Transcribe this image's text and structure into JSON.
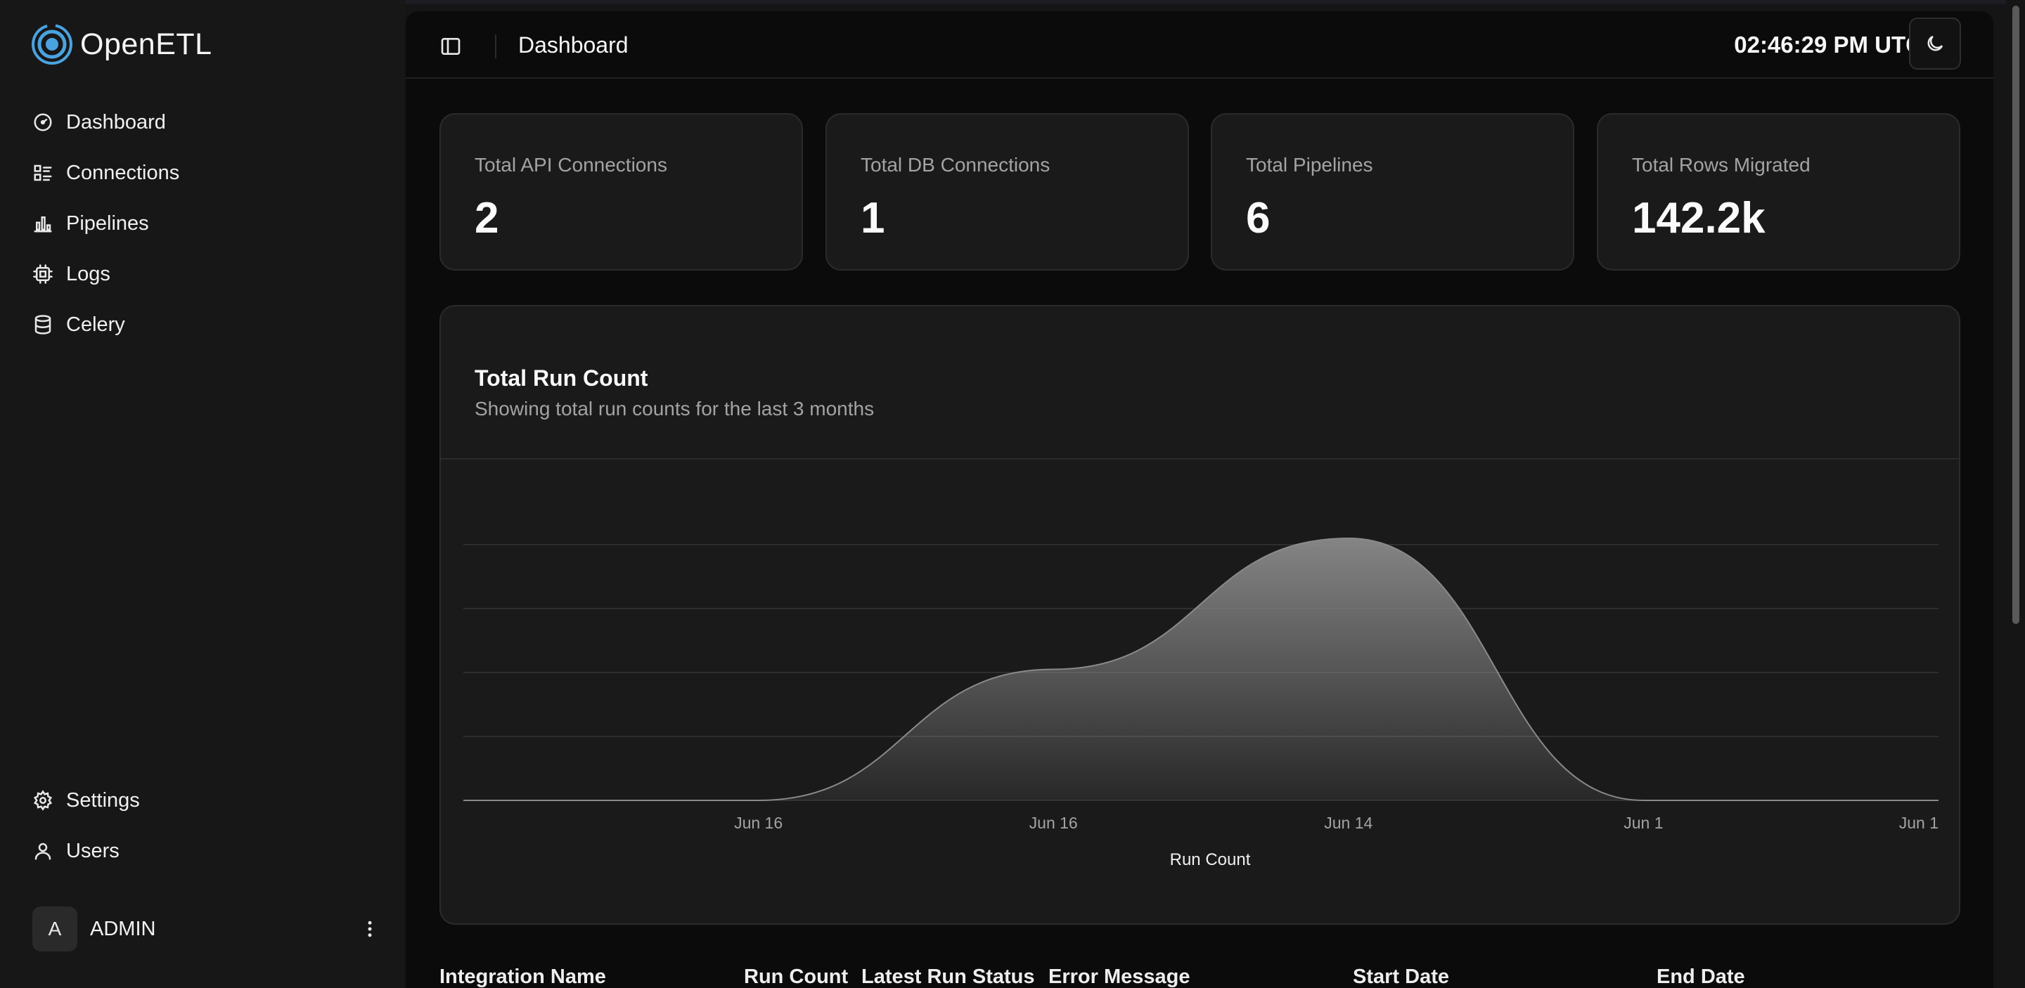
{
  "brand": {
    "name": "OpenETL",
    "logo_icon": "openetl-logo-icon",
    "accent": "#4aa3e0"
  },
  "sidebar": {
    "items": [
      {
        "label": "Dashboard",
        "icon": "gauge-icon"
      },
      {
        "label": "Connections",
        "icon": "list-icon"
      },
      {
        "label": "Pipelines",
        "icon": "bar-chart-icon"
      },
      {
        "label": "Logs",
        "icon": "chip-icon"
      },
      {
        "label": "Celery",
        "icon": "database-icon"
      }
    ],
    "bottom_items": [
      {
        "label": "Settings",
        "icon": "gear-icon"
      },
      {
        "label": "Users",
        "icon": "user-icon"
      }
    ],
    "user": {
      "initial": "A",
      "name": "ADMIN",
      "menu_icon": "more-vertical-icon"
    }
  },
  "header": {
    "title": "Dashboard",
    "clock": "02:46:29 PM UTC",
    "sidebar_toggle_icon": "panel-left-icon",
    "theme_icon": "moon-icon"
  },
  "stats": [
    {
      "label": "Total API Connections",
      "value": "2"
    },
    {
      "label": "Total DB Connections",
      "value": "1"
    },
    {
      "label": "Total Pipelines",
      "value": "6"
    },
    {
      "label": "Total Rows Migrated",
      "value": "142.2k"
    }
  ],
  "chart": {
    "title": "Total Run Count",
    "subtitle": "Showing total run counts for the last 3 months",
    "legend": "Run Count"
  },
  "chart_data": {
    "type": "area",
    "title": "Total Run Count",
    "subtitle": "Showing total run counts for the last 3 months",
    "x": [
      "",
      "Jun 16",
      "Jun 16",
      "Jun 14",
      "Jun 1",
      "Jun 1"
    ],
    "series": [
      {
        "name": "Run Count",
        "values": [
          0,
          0,
          2,
          4,
          0,
          0
        ]
      }
    ],
    "x_tick_labels": [
      "Jun 16",
      "Jun 16",
      "Jun 14",
      "Jun 1",
      "Jun 1"
    ],
    "ylim": [
      0,
      4
    ],
    "grid": true,
    "legend_position": "bottom",
    "fill_color": "#8a8a8a"
  },
  "table": {
    "columns": [
      "Integration Name",
      "Run Count",
      "Latest Run Status",
      "Error Message",
      "Start Date",
      "End Date"
    ]
  }
}
